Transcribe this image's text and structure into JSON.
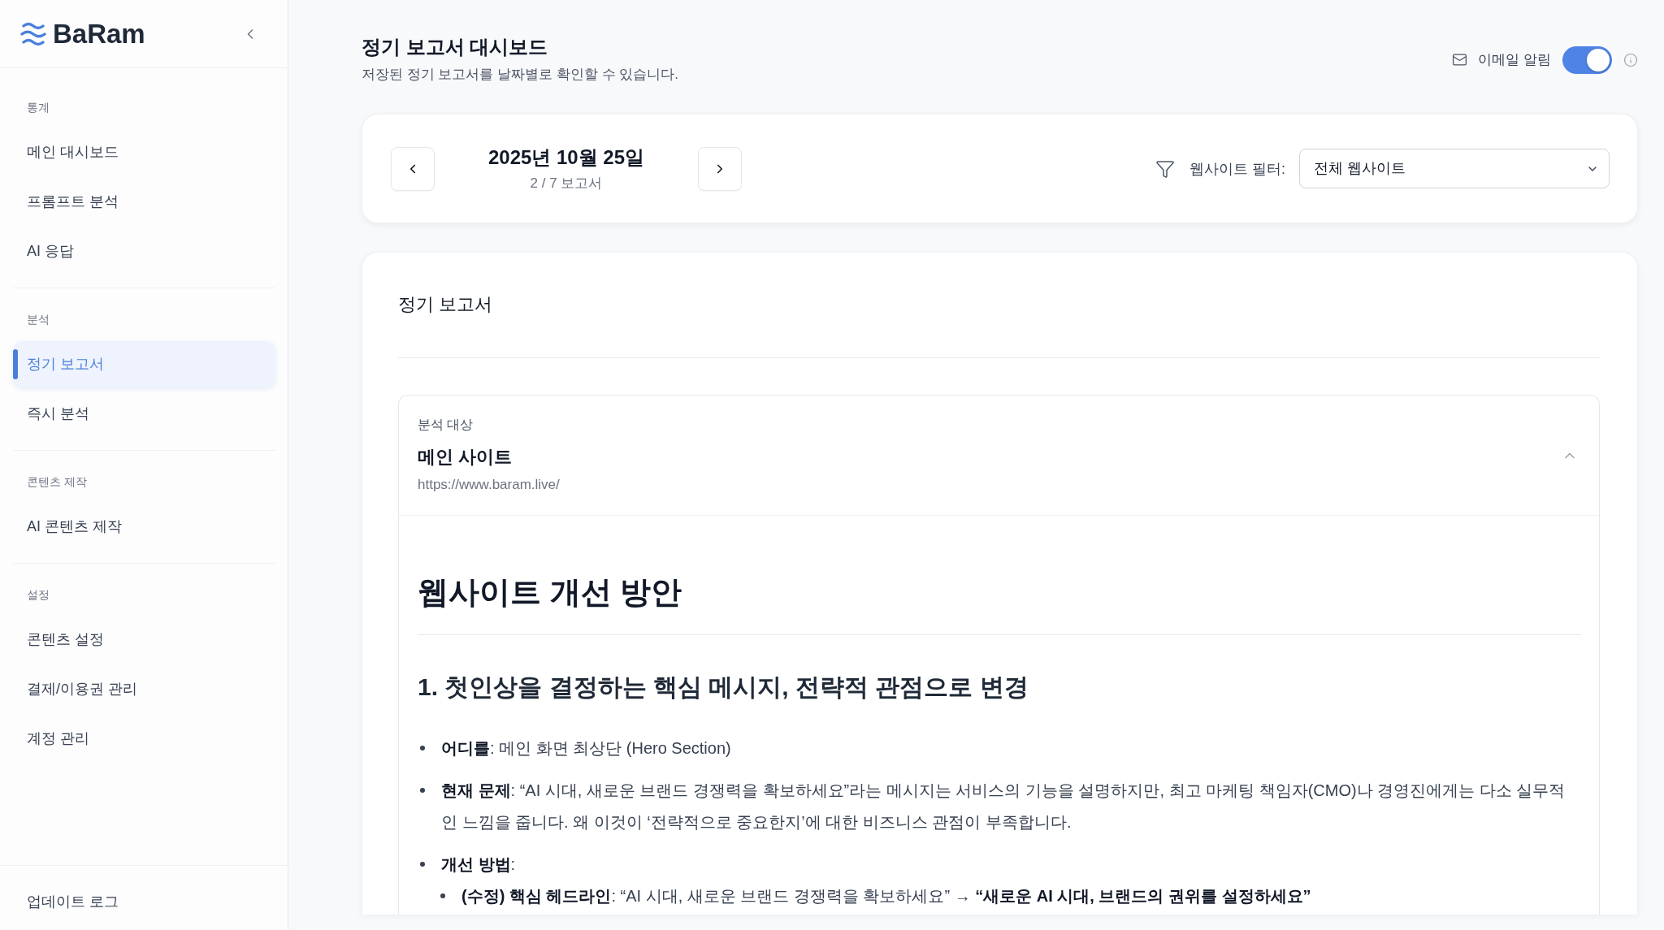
{
  "sidebar": {
    "logo": "BaRam",
    "groups": [
      {
        "title": "통계",
        "items": [
          {
            "label": "메인 대시보드",
            "selected": false
          },
          {
            "label": "프롬프트 분석",
            "selected": false
          },
          {
            "label": "AI 응답",
            "selected": false
          }
        ]
      },
      {
        "title": "분석",
        "items": [
          {
            "label": "정기 보고서",
            "selected": true
          },
          {
            "label": "즉시 분석",
            "selected": false
          }
        ]
      },
      {
        "title": "콘텐츠 제작",
        "items": [
          {
            "label": "AI 콘텐츠 제작",
            "selected": false
          }
        ]
      },
      {
        "title": "설정",
        "items": [
          {
            "label": "콘텐츠 설정",
            "selected": false
          },
          {
            "label": "결제/이용권 관리",
            "selected": false
          },
          {
            "label": "계정 관리",
            "selected": false
          }
        ]
      }
    ],
    "footer_item": "업데이트 로그"
  },
  "header": {
    "title": "정기 보고서 대시보드",
    "subtitle": "저장된 정기 보고서를 날짜별로 확인할 수 있습니다.",
    "email_alert": {
      "label": "이메일 알림",
      "on": true
    }
  },
  "date_nav": {
    "date": "2025년 10월 25일",
    "position": "2 / 7 보고서",
    "filter": {
      "label": "웹사이트 필터:",
      "value": "전체 웹사이트"
    }
  },
  "report": {
    "title": "정기 보고서",
    "target": {
      "label": "분석 대상",
      "name": "메인 사이트",
      "url": "https://www.baram.live/",
      "expanded": true
    },
    "heading": "웹사이트 개선 방안",
    "sections": [
      {
        "heading": "1. 첫인상을 결정하는 핵심 메시지, 전략적 관점으로 변경",
        "items": [
          {
            "text": "**어디를**: 메인 화면 최상단 (Hero Section)"
          },
          {
            "text": "**현재 문제**: “AI 시대, 새로운 브랜드 경쟁력을 확보하세요”라는 메시지는 서비스의 기능을 설명하지만, 최고 마케팅 책임자(CMO)나 경영진에게는 다소 실무적인 느낌을 줍니다. 왜 이것이 ‘전략적으로 중요한지’에 대한 비즈니스 관점이 부족합니다."
          },
          {
            "text": "**개선 방법**:",
            "children": [
              {
                "text": "**(수정) 핵심 헤드라인**: “AI 시대, 새로운 브랜드 경쟁력을 확보하세요” → **“새로운 AI 시대, 브랜드의 권위를 설정하세요”**"
              }
            ]
          }
        ]
      }
    ]
  }
}
